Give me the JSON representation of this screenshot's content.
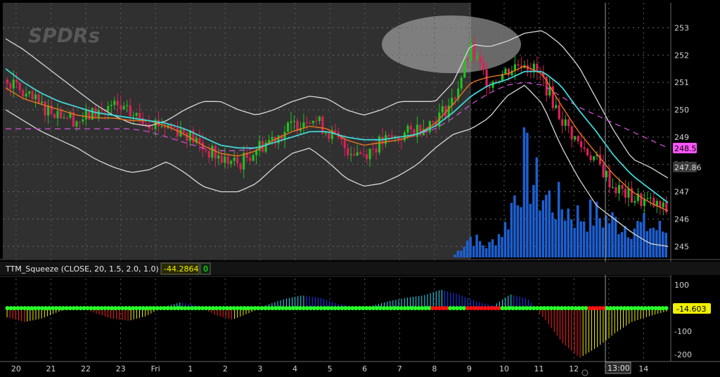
{
  "watermark": "SPDRs",
  "indicator": {
    "label": "TTM_Squeeze (CLOSE, 20, 1.5, 2.0, 1.0)",
    "value": "-44.2864",
    "flag": "0"
  },
  "badges": {
    "price1": "248.53",
    "price2": "247.86",
    "lower": "-14.603",
    "cursor_time": "13:00"
  },
  "colors": {
    "up": "#21c021",
    "down": "#e01e5a",
    "volume": "#1e5fd0",
    "bands": "#d8d8d8",
    "ema_fast": "#e8761e",
    "ema_slow": "#3fd6d6",
    "dashed": "#c84fd0",
    "squeeze_on": "#ff1010",
    "squeeze_off": "#28ff28"
  },
  "chart_data": [
    {
      "type": "candlestick",
      "title": "",
      "price_ticks": [
        245,
        246,
        247,
        248,
        249,
        250,
        251,
        252,
        253
      ],
      "ylim": [
        244.75,
        253.5
      ],
      "date_ticks": [
        "20",
        "21",
        "22",
        "23",
        "Fri",
        "1",
        "2",
        "3",
        "4",
        "5",
        "6",
        "7",
        "8",
        "9",
        "10",
        "11",
        "12",
        "13",
        "14"
      ],
      "series": [
        {
          "name": "close",
          "values": [
            251.1,
            250.5,
            250.1,
            249.9,
            249.6,
            249.9,
            250.1,
            249.8,
            249.6,
            249.4,
            249.2,
            248.6,
            248.2,
            248.0,
            248.6,
            249.0,
            249.4,
            249.8,
            249.2,
            248.6,
            248.4,
            248.8,
            249.0,
            249.3,
            249.6,
            250.3,
            252.2,
            251.0,
            251.4,
            251.8,
            251.2,
            249.8,
            248.8,
            248.2,
            247.2,
            246.8,
            246.6,
            246.3
          ]
        },
        {
          "name": "volume",
          "values": [
            0,
            0,
            0,
            0,
            0,
            0,
            0,
            0,
            0,
            0,
            0,
            0,
            0,
            0,
            0,
            0,
            0,
            0,
            0,
            0,
            0,
            0,
            0,
            0,
            0,
            0,
            0.2,
            0.1,
            0.3,
            0.9,
            0.6,
            0.5,
            0.4,
            0.4,
            0.35,
            0.3,
            0.3,
            0.25
          ]
        },
        {
          "name": "upper_band",
          "values": [
            252.6,
            252.2,
            251.7,
            251.2,
            250.7,
            250.2,
            249.8,
            249.5,
            249.4,
            249.6,
            250.0,
            250.3,
            250.3,
            250.0,
            249.8,
            250.0,
            250.3,
            250.5,
            250.4,
            250.0,
            249.8,
            250.0,
            250.3,
            250.3,
            250.3,
            251.0,
            252.4,
            252.3,
            252.5,
            252.8,
            252.9,
            252.4,
            251.6,
            250.4,
            249.2,
            248.2,
            247.9,
            247.5
          ]
        },
        {
          "name": "lower_band",
          "values": [
            250.0,
            249.6,
            249.2,
            248.9,
            248.6,
            248.2,
            247.9,
            247.7,
            247.8,
            248.1,
            247.7,
            247.2,
            247.0,
            247.0,
            247.3,
            247.9,
            248.4,
            248.6,
            248.1,
            247.5,
            247.2,
            247.3,
            247.6,
            248.0,
            248.6,
            249.1,
            249.3,
            249.7,
            250.5,
            250.9,
            250.2,
            248.7,
            247.5,
            246.5,
            246.0,
            245.5,
            245.1,
            245.0
          ]
        },
        {
          "name": "ema_fast",
          "values": [
            250.8,
            250.4,
            250.2,
            250.0,
            249.8,
            249.7,
            249.7,
            249.6,
            249.6,
            249.4,
            249.1,
            248.7,
            248.4,
            248.3,
            248.5,
            248.9,
            249.2,
            249.4,
            249.3,
            248.9,
            248.7,
            248.8,
            248.9,
            249.1,
            249.5,
            250.2,
            251.0,
            251.2,
            251.3,
            251.6,
            251.3,
            250.2,
            249.2,
            248.4,
            247.6,
            247.0,
            246.6,
            246.3
          ]
        },
        {
          "name": "ema_slow",
          "values": [
            251.5,
            251.0,
            250.6,
            250.3,
            250.1,
            249.9,
            249.8,
            249.7,
            249.6,
            249.5,
            249.3,
            249.0,
            248.7,
            248.6,
            248.6,
            248.8,
            249.0,
            249.2,
            249.2,
            249.0,
            248.9,
            248.9,
            249.0,
            249.1,
            249.4,
            249.9,
            250.5,
            250.9,
            251.1,
            251.4,
            251.4,
            250.9,
            250.0,
            249.2,
            248.3,
            247.6,
            247.1,
            246.6
          ]
        },
        {
          "name": "dashed_level",
          "values": [
            249.3,
            249.3,
            249.3,
            249.3,
            249.3,
            249.3,
            249.3,
            249.3,
            249.2,
            249.0,
            248.8,
            248.6,
            248.5,
            248.5,
            248.6,
            248.8,
            249.0,
            249.2,
            249.2,
            249.0,
            248.9,
            248.9,
            249.0,
            249.1,
            249.3,
            249.7,
            250.2,
            250.6,
            250.9,
            251.0,
            250.9,
            250.5,
            250.1,
            249.8,
            249.5,
            249.2,
            248.9,
            248.6
          ]
        }
      ]
    },
    {
      "type": "histogram",
      "title": "TTM_Squeeze",
      "yticks": [
        100,
        0,
        -100,
        -200
      ],
      "ylim": [
        -225,
        125
      ],
      "series": [
        {
          "name": "momentum",
          "values": [
            -40,
            -60,
            -45,
            -15,
            10,
            -20,
            -45,
            -55,
            -35,
            5,
            25,
            10,
            -30,
            -50,
            -20,
            15,
            40,
            55,
            45,
            20,
            5,
            10,
            30,
            45,
            55,
            80,
            60,
            30,
            10,
            60,
            40,
            -50,
            -150,
            -215,
            -170,
            -110,
            -60,
            -35,
            -14.6
          ]
        },
        {
          "name": "squeeze",
          "values": [
            0,
            0,
            0,
            0,
            0,
            0,
            0,
            0,
            0,
            0,
            0,
            0,
            0,
            0,
            0,
            0,
            0,
            0,
            0,
            0,
            0,
            0,
            0,
            0,
            0,
            1,
            0,
            1,
            1,
            0,
            0,
            0,
            0,
            0,
            1,
            0,
            0,
            0,
            0
          ]
        }
      ]
    }
  ]
}
